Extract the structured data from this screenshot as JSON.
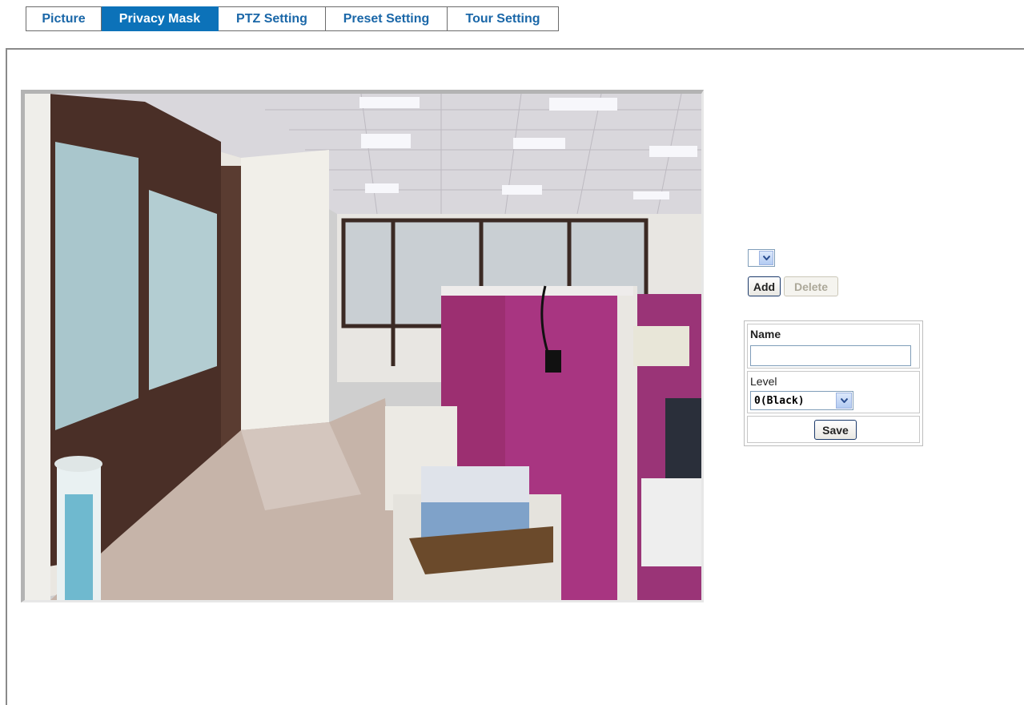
{
  "tabs": [
    {
      "label": "Picture",
      "active": false
    },
    {
      "label": "Privacy Mask",
      "active": true
    },
    {
      "label": "PTZ Setting",
      "active": false
    },
    {
      "label": "Preset Setting",
      "active": false
    },
    {
      "label": "Tour Setting",
      "active": false
    }
  ],
  "colors": {
    "tab_text": "#1a67a8",
    "tab_active_bg": "#0c72b9",
    "tab_active_text": "#ffffff"
  },
  "mask_select": {
    "value": ""
  },
  "buttons": {
    "add": "Add",
    "delete": "Delete",
    "save": "Save"
  },
  "form": {
    "name_label": "Name",
    "name_value": "",
    "level_label": "Level",
    "level_value": "0(Black)"
  },
  "icons": {
    "dropdown_arrow": "chevron-down-icon",
    "video": "camera-live-view"
  }
}
